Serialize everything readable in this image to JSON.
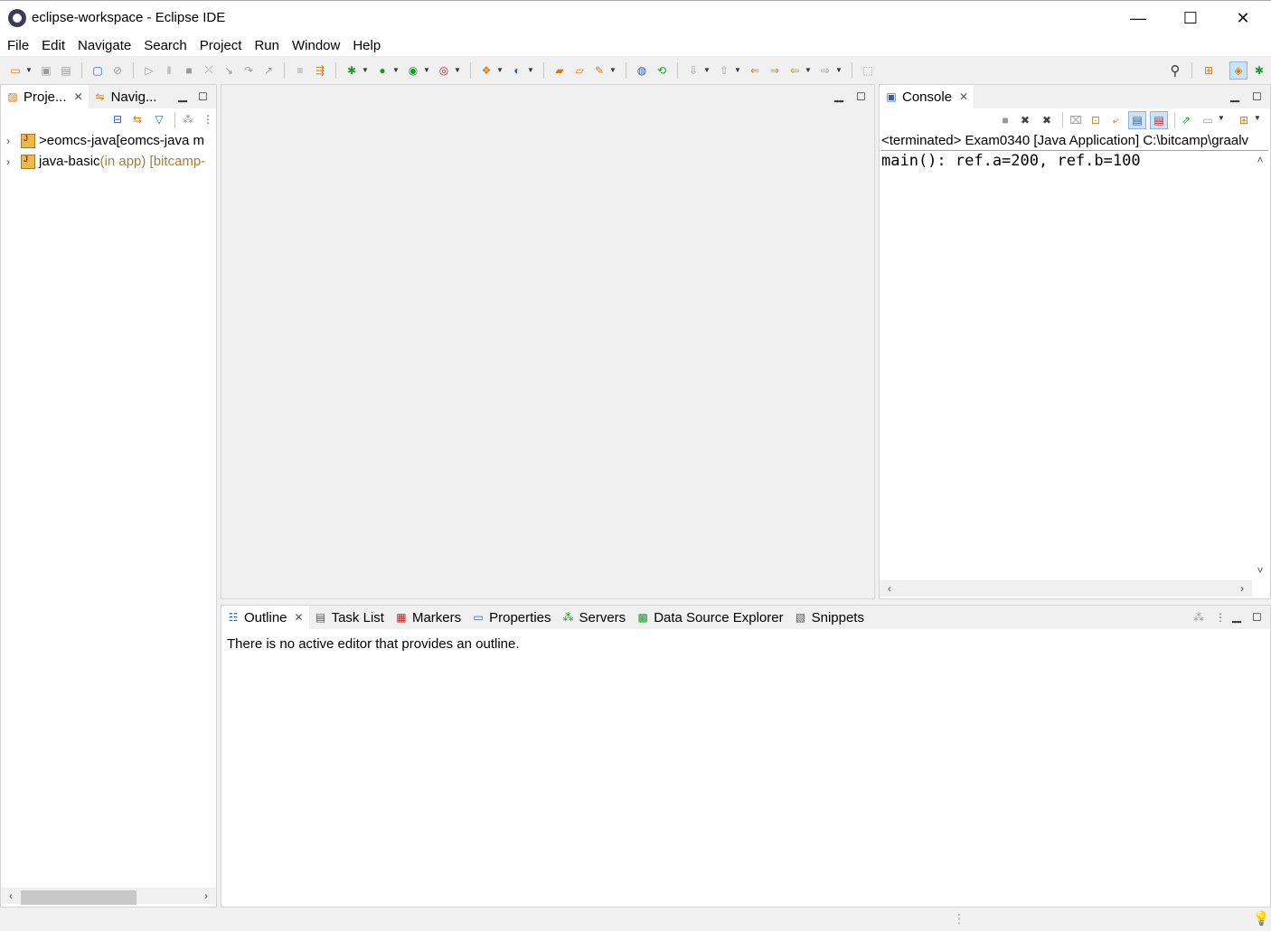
{
  "window": {
    "title": "eclipse-workspace - Eclipse IDE",
    "minimize_glyph": "—",
    "maximize_glyph": "☐",
    "close_glyph": "✕"
  },
  "menu": [
    "File",
    "Edit",
    "Navigate",
    "Search",
    "Project",
    "Run",
    "Window",
    "Help"
  ],
  "project_explorer": {
    "tabs": [
      {
        "label": "Proje...",
        "icon": "package-explorer-icon",
        "active": true
      },
      {
        "label": "Navig...",
        "icon": "navigator-icon",
        "active": false
      }
    ],
    "items": [
      {
        "prefix": "> ",
        "name": "eomcs-java",
        "decoration": " [eomcs-java m",
        "decoration_color": "#000000"
      },
      {
        "prefix": "",
        "name": "java-basic",
        "decoration": " (in app) [bitcamp-",
        "decoration_color": "#a08040"
      }
    ]
  },
  "console": {
    "tab_label": "Console",
    "status": "<terminated> Exam0340 [Java Application] C:\\bitcamp\\graalv",
    "output": "main(): ref.a=200, ref.b=100"
  },
  "bottom_panel": {
    "tabs": [
      {
        "label": "Outline",
        "icon": "outline-icon",
        "active": true
      },
      {
        "label": "Task List",
        "icon": "task-list-icon",
        "active": false
      },
      {
        "label": "Markers",
        "icon": "markers-icon",
        "active": false
      },
      {
        "label": "Properties",
        "icon": "properties-icon",
        "active": false
      },
      {
        "label": "Servers",
        "icon": "servers-icon",
        "active": false
      },
      {
        "label": "Data Source Explorer",
        "icon": "data-source-icon",
        "active": false
      },
      {
        "label": "Snippets",
        "icon": "snippets-icon",
        "active": false
      }
    ],
    "message": "There is no active editor that provides an outline."
  },
  "colors": {
    "accent": "#2a5db0",
    "run_green": "#1a9a2a",
    "decoration": "#a08040"
  }
}
